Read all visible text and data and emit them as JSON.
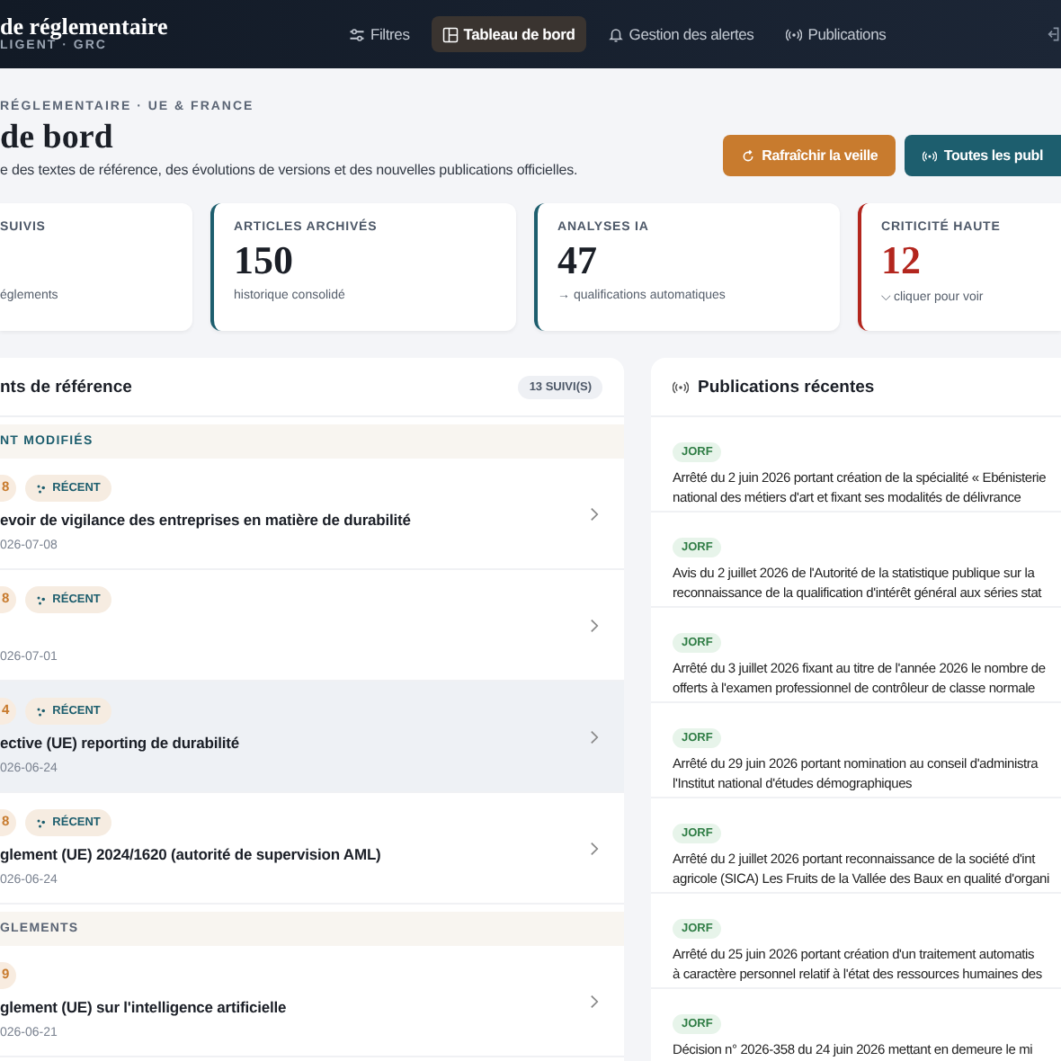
{
  "header": {
    "brand": "de réglementaire",
    "brand_sub": "LIGENT · GRC",
    "nav": [
      {
        "label": "Filtres",
        "selected": false
      },
      {
        "label": "Tableau de bord",
        "selected": true
      },
      {
        "label": "Gestion des alertes",
        "selected": false
      },
      {
        "label": "Publications",
        "selected": false
      }
    ]
  },
  "page": {
    "eyebrow": "RÉGLEMENTAIRE · UE & FRANCE",
    "title": "de bord",
    "subtitle": "e des textes de référence, des évolutions de versions et des nouvelles publications officielles.",
    "buttons": [
      {
        "label": "Rafraîchir la veille",
        "kind": "refresh"
      },
      {
        "label": "Toutes les publ",
        "kind": "broadcast"
      }
    ]
  },
  "stats": [
    {
      "label": "SUIVIS",
      "note": "églements"
    },
    {
      "label": "ARTICLES ARCHIVÉS",
      "value": "150",
      "note": "historique consolidé",
      "color": "#1d5e6e"
    },
    {
      "label": "ANALYSES IA",
      "value": "47",
      "note": "→ qualifications automatiques",
      "color": "#1d5e6e"
    },
    {
      "label": "CRITICITÉ HAUTE",
      "value": "12",
      "note": "⌵ cliquer pour voir",
      "color": "#b3261e"
    }
  ],
  "references": {
    "title": "nts de référence",
    "count": "13 SUIVI(S)",
    "groups": [
      {
        "heading": "NT MODIFIÉS",
        "items": [
          {
            "version": "8",
            "tag": "RÉCENT",
            "title": "evoir de vigilance des entreprises en matière de durabilité",
            "date": "026-07-08",
            "selected": false
          },
          {
            "version": "8",
            "tag": "RÉCENT",
            "date": "026-07-01",
            "selected": false
          },
          {
            "version": "4",
            "tag": "RÉCENT",
            "title": "ective (UE) reporting de durabilité",
            "date": "026-06-24",
            "selected": true
          },
          {
            "version": "8",
            "tag": "RÉCENT",
            "title": "glement (UE) 2024/1620 (autorité de supervision AML)",
            "date": "026-06-24",
            "selected": false
          }
        ]
      },
      {
        "heading": "GLEMENTS",
        "items": [
          {
            "version": "9",
            "title": "glement (UE) sur l'intelligence artificielle",
            "date": "026-06-21",
            "selected": false
          }
        ]
      }
    ]
  },
  "publications": {
    "title": "Publications récentes",
    "items": [
      {
        "source": "JORF",
        "text": "Arrêté du 2 juin 2026 portant création de la spécialité « Ebénisterie\nnational des métiers d'art et fixant ses modalités de délivrance"
      },
      {
        "source": "JORF",
        "text": "Avis du 2 juillet 2026 de l'Autorité de la statistique publique sur la\nreconnaissance de la qualification d'intérêt général aux séries stat"
      },
      {
        "source": "JORF",
        "text": "Arrêté du 3 juillet 2026 fixant au titre de l'année 2026 le nombre de\nofferts à l'examen professionnel de contrôleur de classe normale"
      },
      {
        "source": "JORF",
        "text": "Arrêté du 29 juin 2026 portant nomination au conseil d'administra\nl'Institut national d'études démographiques"
      },
      {
        "source": "JORF",
        "text": "Arrêté du 2 juillet 2026 portant reconnaissance de la société d'int\nagricole (SICA) Les Fruits de la Vallée des Baux en qualité d'organi"
      },
      {
        "source": "JORF",
        "text": "Arrêté du 25 juin 2026 portant création d'un traitement automatis\nà caractère personnel relatif à l'état des ressources humaines des"
      },
      {
        "source": "JORF",
        "text": "Décision n° 2026-358 du 24 juin 2026 mettant en demeure le mi"
      }
    ]
  }
}
